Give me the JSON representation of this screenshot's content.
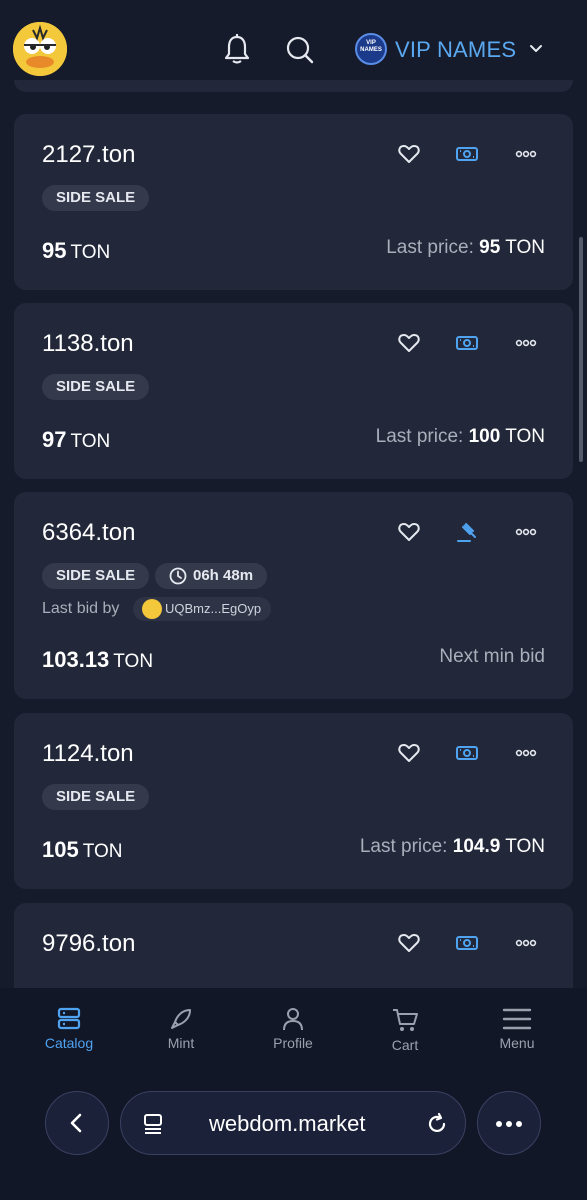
{
  "header": {
    "vip_badge_text": "VIP NAMES",
    "vip_label": "VIP NAMES"
  },
  "cards": [
    {
      "name": "2127.ton",
      "chip": "SIDE SALE",
      "price": "95",
      "unit": "TON",
      "last_label": "Last price:",
      "last_value": "95",
      "last_unit": "TON"
    },
    {
      "name": "1138.ton",
      "chip": "SIDE SALE",
      "price": "97",
      "unit": "TON",
      "last_label": "Last price:",
      "last_value": "100",
      "last_unit": "TON"
    },
    {
      "name": "6364.ton",
      "chip": "SIDE SALE",
      "timer": "06h 48m",
      "last_bid_label": "Last bid by",
      "bidder": "UQBmz...EgOyp",
      "price": "103.13",
      "unit": "TON",
      "next_label": "Next min bid"
    },
    {
      "name": "1124.ton",
      "chip": "SIDE SALE",
      "price": "105",
      "unit": "TON",
      "last_label": "Last price:",
      "last_value": "104.9",
      "last_unit": "TON"
    },
    {
      "name": "9796.ton"
    }
  ],
  "tabs": [
    {
      "label": "Catalog",
      "icon": "catalog-icon",
      "active": true
    },
    {
      "label": "Mint",
      "icon": "rocket-icon",
      "active": false
    },
    {
      "label": "Profile",
      "icon": "profile-icon",
      "active": false
    },
    {
      "label": "Cart",
      "icon": "cart-icon",
      "active": false
    },
    {
      "label": "Menu",
      "icon": "menu-icon",
      "active": false
    }
  ],
  "browser": {
    "url": "webdom.market"
  },
  "colors": {
    "background": "#161b2c",
    "card": "#222839",
    "accent": "#4fa3f0",
    "chip": "#343a4c"
  }
}
